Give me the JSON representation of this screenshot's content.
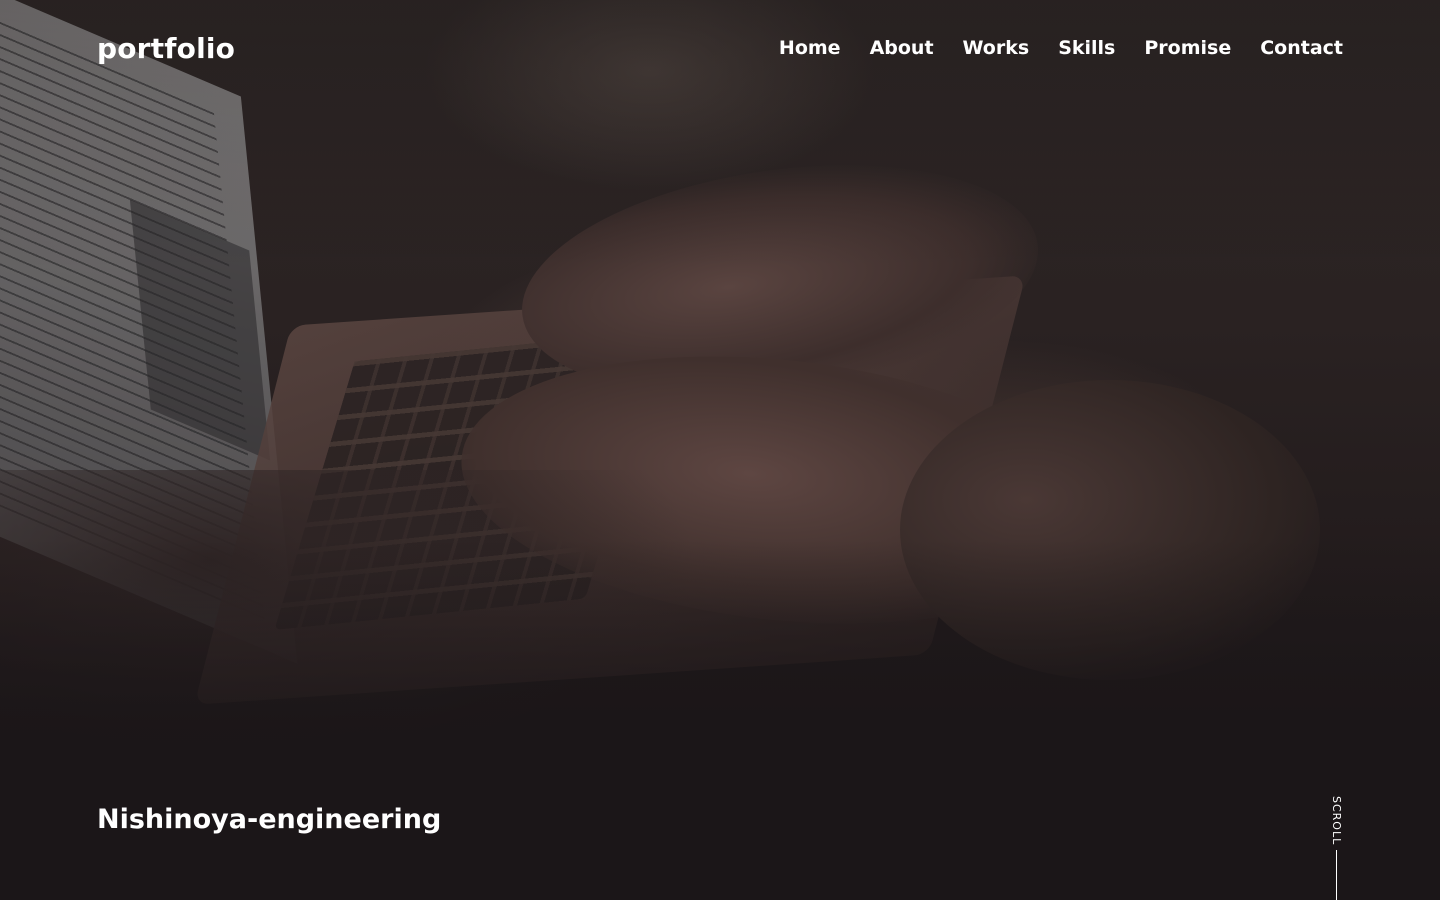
{
  "header": {
    "logo": "portfolio",
    "nav": [
      {
        "label": "Home"
      },
      {
        "label": "About"
      },
      {
        "label": "Works"
      },
      {
        "label": "Skills"
      },
      {
        "label": "Promise"
      },
      {
        "label": "Contact"
      }
    ]
  },
  "hero": {
    "tagline": "Nishinoya-engineering",
    "scroll_label": "SCROLL",
    "background_icon": "laptop-typing-photo"
  },
  "colors": {
    "text": "#ffffff",
    "background": "#1b1618"
  }
}
